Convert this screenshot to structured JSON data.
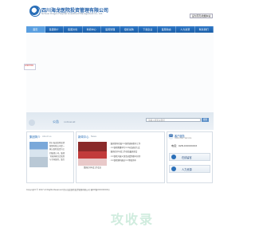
{
  "header": {
    "company_cn": "四川海龙医院投资管理有限公司",
    "company_en": "Sichuan Dragon Hospital Investment Management Co., Ltd.",
    "top_link": "设为首页|收藏本站"
  },
  "nav": {
    "items": [
      "首页",
      "集团简介",
      "集团文化",
      "新闻中心",
      "医院管理",
      "招标采购",
      "下载企业",
      "医院动态",
      "人力资源",
      "联系我们"
    ],
    "active_index": 0
  },
  "side_badge": "CERTIFIED",
  "band": {
    "title": "公告",
    "title_en": "noticeList",
    "search_placeholder": "请输入搜索关键词",
    "search_button": "搜索"
  },
  "panels": {
    "intro": {
      "title": "集团简介",
      "title_en": "About us",
      "lines": [
        "四川海龙医院投资",
        "管理有限公司是一",
        "家以医院投资为主",
        "的集团公司，集团",
        "下属多家综合医院",
        "与专科医院，致力"
      ]
    },
    "news": {
      "title": "新闻中心",
      "title_en": "News",
      "image_caption": "集团召开年度工作会议",
      "items": [
        "集团领导莅临××医院调研指导工作",
        "××医院隆重举行××年度表彰大会",
        "集团召开年度工作总结暨表彰会",
        "××医院开展义诊活动受到群众好评",
        "××医院顺利通过××等级评审"
      ]
    },
    "contact": {
      "title": "客户服务",
      "title_en": "Customer Service",
      "hotline": "电话：028-XXXXXXXX",
      "links": [
        "在线留言",
        "人力资源"
      ]
    }
  },
  "footer": {
    "copyright": "Copyright © 2017 All Rights Reserved  四川海龙医院投资管理有限公司  蜀ICP备XXXXXXXX号"
  },
  "watermark": "攻收录",
  "colors": {
    "brand_blue": "#1f5ea8",
    "nav_blue": "#2f78c7",
    "active_nav": "#5a9fe0",
    "band_bg": "#dfe8f0"
  }
}
